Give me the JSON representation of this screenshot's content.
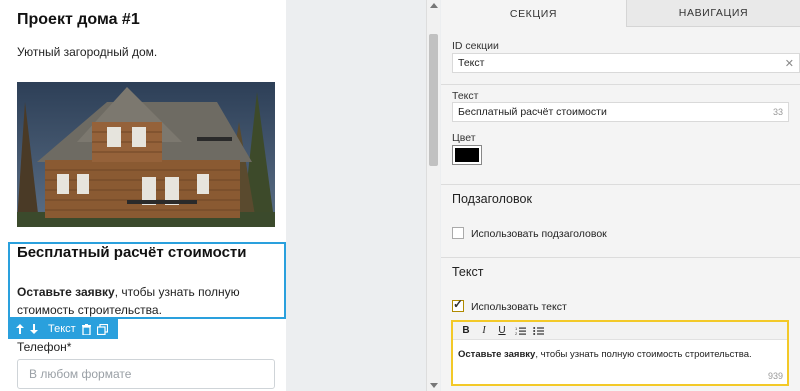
{
  "preview": {
    "title": "Проект дома #1",
    "description": "Уютный загородный дом.",
    "selected_block": {
      "heading": "Бесплатный расчёт стоимости",
      "text_bold": "Оставьте заявку",
      "text_rest": ", чтобы узнать полную стоимость строительства."
    },
    "block_toolbar": {
      "label": "Текст"
    },
    "phone_label": "Телефон*",
    "phone_placeholder": "В любом формате"
  },
  "panel": {
    "tabs": [
      {
        "label": "СЕКЦИЯ",
        "active": true
      },
      {
        "label": "НАВИГАЦИЯ",
        "active": false
      }
    ],
    "section_id": {
      "label": "ID секции",
      "value": "Текст"
    },
    "text_field": {
      "label": "Текст",
      "value": "Бесплатный расчёт стоимости",
      "counter": "33"
    },
    "color": {
      "label": "Цвет",
      "value": "#000000"
    },
    "subheading": {
      "title": "Подзаголовок",
      "checkbox_label": "Использовать подзаголовок",
      "checked": false
    },
    "text_section": {
      "title": "Текст",
      "checkbox_label": "Использовать текст",
      "checked": true,
      "editor": {
        "toolbar": [
          "B",
          "I",
          "U",
          "numbered-list",
          "bulleted-list"
        ],
        "content_bold": "Оставьте заявку",
        "content_rest": ", чтобы узнать полную стоимость строительства.",
        "counter": "939"
      }
    }
  },
  "colors": {
    "accent_blue": "#2aa0dd",
    "editor_border": "#f3c928",
    "panel_bg": "#f4f4f4"
  }
}
